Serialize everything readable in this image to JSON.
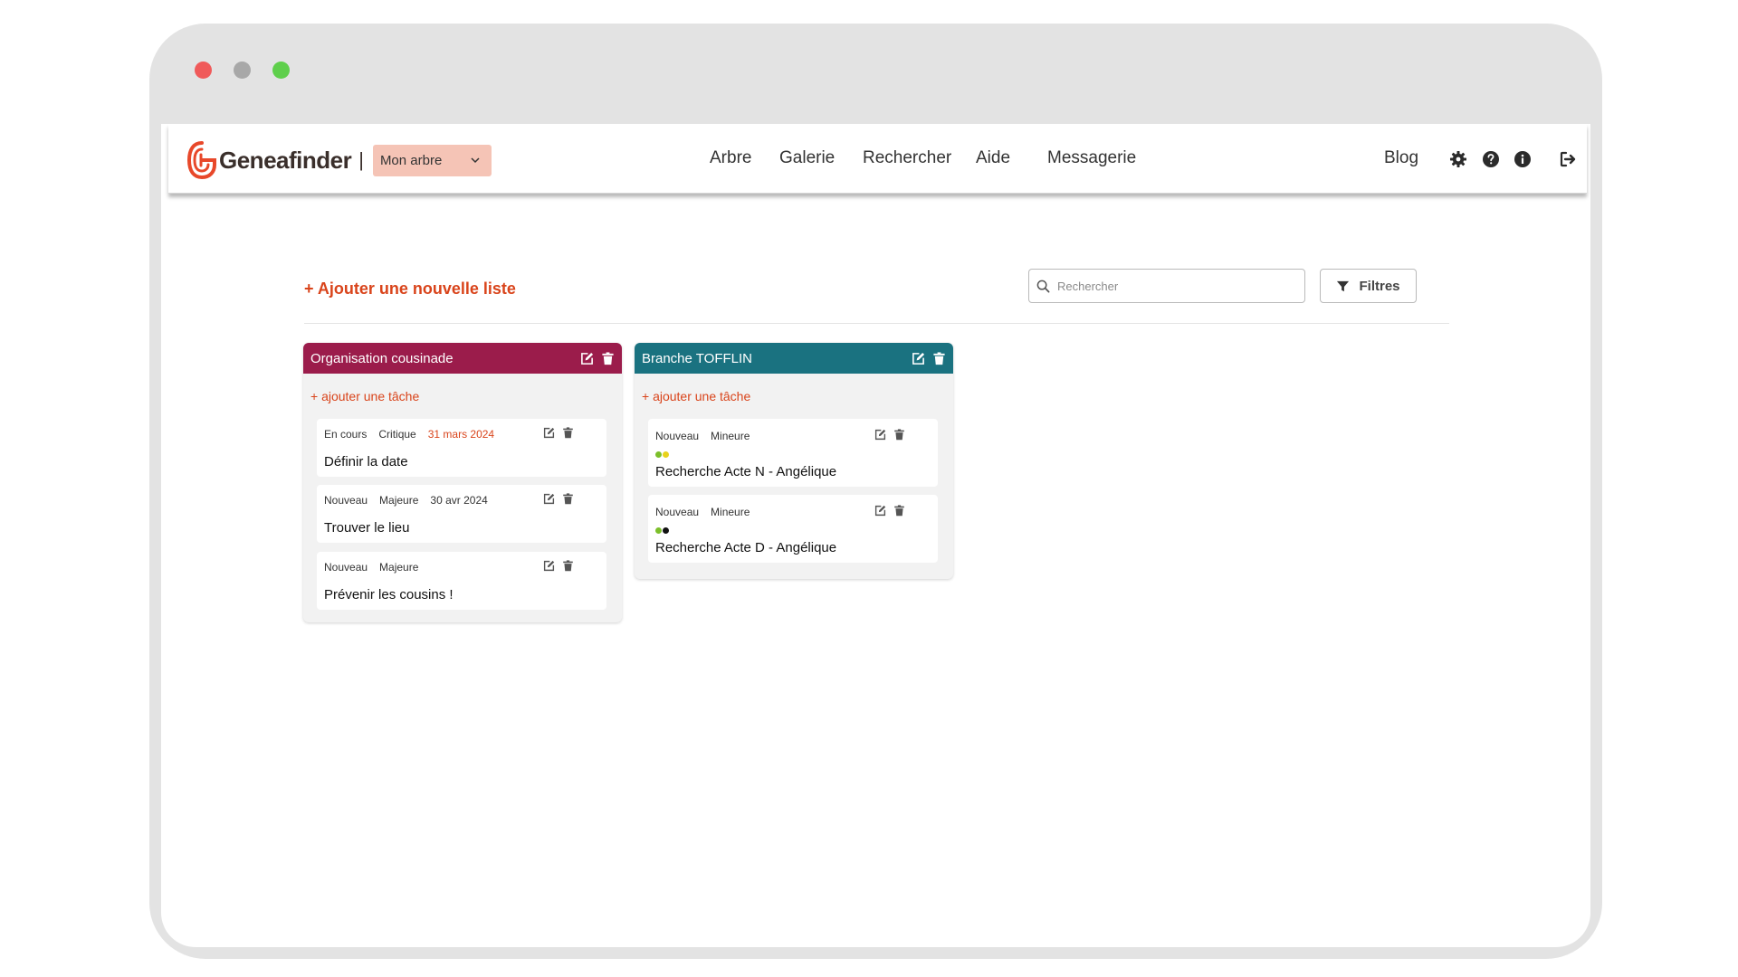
{
  "window": {
    "traffic_lights": [
      "#f05a5a",
      "#a8a8a8",
      "#5fcf4c"
    ]
  },
  "navbar": {
    "brand": "Geneafinder",
    "separator": "|",
    "tree_select": "Mon arbre",
    "links": [
      "Arbre",
      "Galerie",
      "Rechercher",
      "Aide",
      "Messagerie",
      "Blog"
    ],
    "icons": [
      "gear-icon",
      "question-circle-icon",
      "info-circle-icon",
      "sign-out-icon"
    ],
    "accent_color": "#d9441b"
  },
  "toolbar": {
    "add_list_label": "+ Ajouter une nouvelle liste",
    "search_placeholder": "Rechercher",
    "filter_label": "Filtres"
  },
  "lists": [
    {
      "title": "Organisation cousinade",
      "color": "#9b1c4b",
      "add_task_label": "+ ajouter une tâche",
      "tasks": [
        {
          "status": "En cours",
          "priority": "Critique",
          "date": "31 mars 2024",
          "date_overdue": true,
          "title": "Définir la date"
        },
        {
          "status": "Nouveau",
          "priority": "Majeure",
          "date": "30 avr 2024",
          "date_overdue": false,
          "title": "Trouver le lieu"
        },
        {
          "status": "Nouveau",
          "priority": "Majeure",
          "date": "",
          "title": "Prévenir les cousins !"
        }
      ]
    },
    {
      "title": "Branche TOFFLIN",
      "color": "#1a7280",
      "add_task_label": "+ ajouter une tâche",
      "tasks": [
        {
          "status": "Nouveau",
          "priority": "Mineure",
          "date": "",
          "dots": [
            "#7cbf2a",
            "#e8d21c"
          ],
          "title": "Recherche Acte N - Angélique"
        },
        {
          "status": "Nouveau",
          "priority": "Mineure",
          "date": "",
          "dots": [
            "#7cbf2a",
            "#111111"
          ],
          "title": "Recherche Acte D - Angélique"
        }
      ]
    }
  ]
}
